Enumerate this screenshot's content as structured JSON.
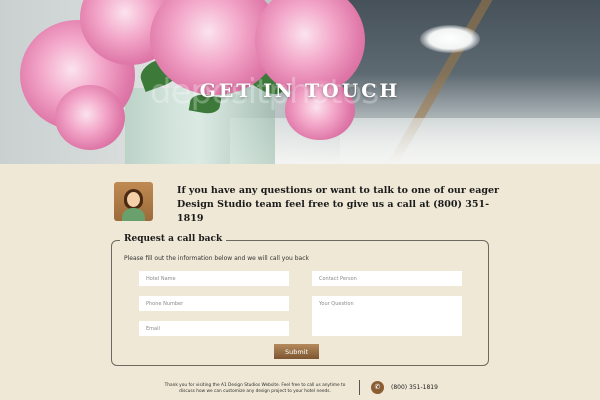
{
  "hero": {
    "title": "GET IN TOUCH",
    "watermark": "depositphotos"
  },
  "intro": {
    "text": "If you have any questions or want to talk to one of our eager Design Studio team feel free to give us a call at (800) 351-1819"
  },
  "form": {
    "legend": "Request a call back",
    "instructions": "Please fill out the information below and we will call you back",
    "fields": {
      "hotel_name": {
        "placeholder": "Hotel Name",
        "value": ""
      },
      "contact_person": {
        "placeholder": "Contact Person",
        "value": ""
      },
      "phone_number": {
        "placeholder": "Phone Number",
        "value": ""
      },
      "your_question": {
        "placeholder": "Your Question",
        "value": ""
      },
      "email": {
        "placeholder": "Email",
        "value": ""
      }
    },
    "submit_label": "Submit"
  },
  "footer": {
    "text": "Thank you for visiting the A1 Design Studios Website. Feel free to call us anytime to discuss how we can customize any design project to your hotel needs.",
    "phone": "(800) 351-1819",
    "phone_icon": "phone-icon"
  },
  "colors": {
    "background": "#efe8d6",
    "accent": "#8a5d33",
    "border": "#6d6a62"
  }
}
